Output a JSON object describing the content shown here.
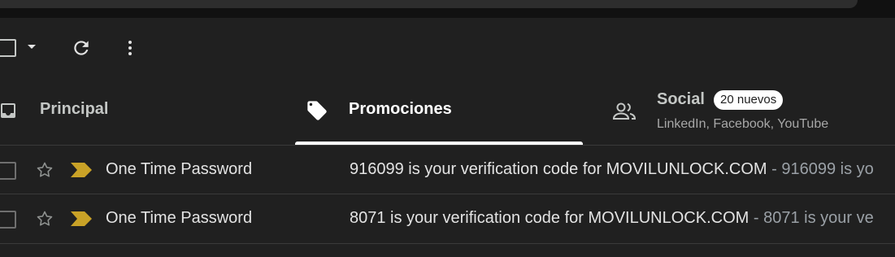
{
  "colors": {
    "background": "#202020",
    "page": "#111111",
    "important_marker": "#c9a227",
    "active_tab_indicator": "#ffffff",
    "text_secondary": "#a8a8a8"
  },
  "toolbar": {
    "select_icon": "checkbox-icon",
    "select_menu_icon": "chevron-down-icon",
    "refresh_icon": "refresh-icon",
    "more_icon": "more-vert-icon"
  },
  "tabs": [
    {
      "label": "Principal",
      "icon": "inbox-icon",
      "selected": false
    },
    {
      "label": "Promociones",
      "icon": "tag-icon",
      "selected": true
    },
    {
      "label": "Social",
      "icon": "people-icon",
      "selected": false,
      "badge": "20 nuevos",
      "subtitle": "LinkedIn, Facebook, YouTube"
    }
  ],
  "emails": [
    {
      "sender": "One Time Password",
      "subject": "916099 is your verification code for MOVILUNLOCK.COM",
      "separator": " - ",
      "preview": "916099 is yo",
      "starred": false,
      "important": true
    },
    {
      "sender": "One Time Password",
      "subject": "8071 is your verification code for MOVILUNLOCK.COM",
      "separator": " - ",
      "preview": "8071 is your ve",
      "starred": false,
      "important": true
    }
  ]
}
